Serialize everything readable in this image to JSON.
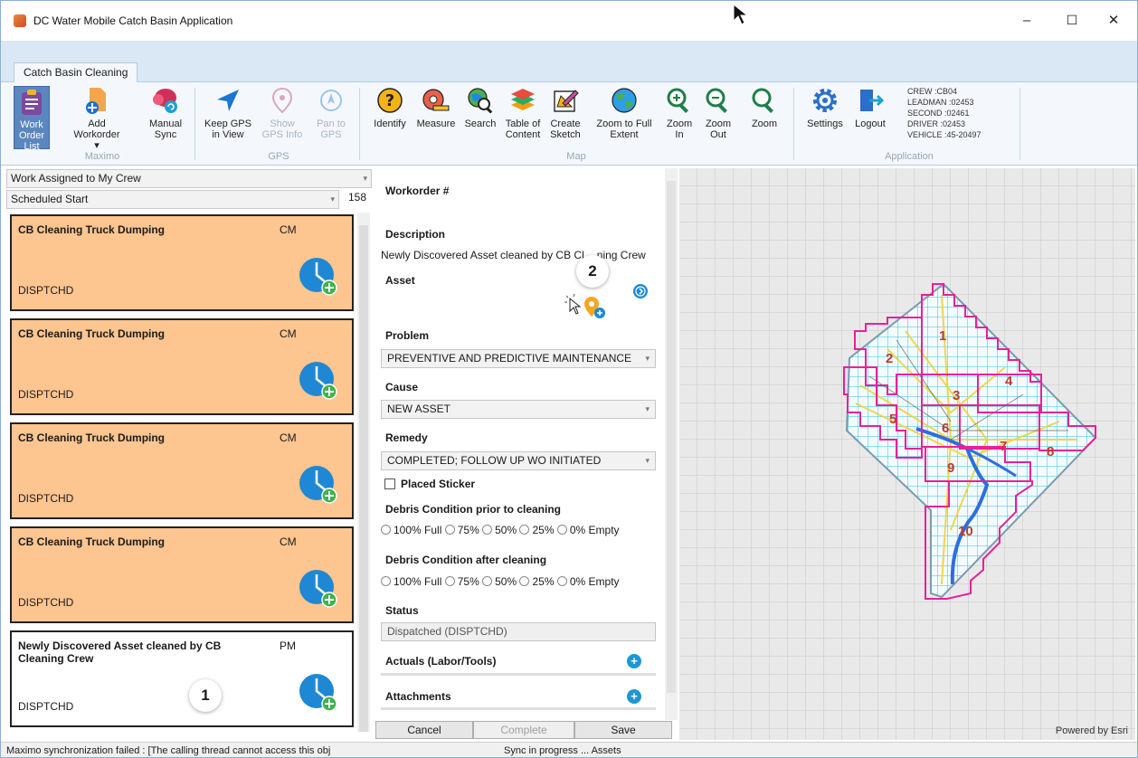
{
  "window": {
    "title": "DC Water Mobile Catch Basin Application",
    "controls": {
      "minimize": "–",
      "maximize": "☐",
      "close": "✕"
    }
  },
  "ribbon": {
    "tab": "Catch Basin Cleaning",
    "groups": {
      "maximo": {
        "label": "Maximo",
        "work_order_list": "Work Order List",
        "add_workorder": "Add Workorder ▾",
        "manual_sync": "Manual Sync"
      },
      "gps": {
        "label": "GPS",
        "keep_gps": "Keep GPS in View",
        "show_gps_info": "Show GPS Info",
        "pan_to_gps": "Pan to GPS"
      },
      "map": {
        "label": "Map",
        "identify": "Identify",
        "measure": "Measure",
        "search": "Search",
        "toc": "Table of Content",
        "sketch": "Create Sketch",
        "full_extent": "Zoom to Full Extent",
        "zoom_in": "Zoom In",
        "zoom_out": "Zoom Out",
        "zoom": "Zoom"
      },
      "application": {
        "label": "Application",
        "settings": "Settings",
        "logout": "Logout",
        "crew": "CREW :CB04",
        "leadman": "LEADMAN :02453",
        "second": "SECOND :02461",
        "driver": "DRIVER :02453",
        "vehicle": "VEHICLE :45-20497"
      }
    }
  },
  "left_panel": {
    "filter": "Work Assigned to My Crew",
    "sort": "Scheduled Start",
    "count": "158",
    "workorders": [
      {
        "title": "CB Cleaning Truck Dumping",
        "type": "CM",
        "status": "DISPTCHD"
      },
      {
        "title": "CB Cleaning Truck Dumping",
        "type": "CM",
        "status": "DISPTCHD"
      },
      {
        "title": "CB Cleaning Truck Dumping",
        "type": "CM",
        "status": "DISPTCHD"
      },
      {
        "title": "CB Cleaning Truck Dumping",
        "type": "CM",
        "status": "DISPTCHD"
      },
      {
        "title": "Newly Discovered Asset cleaned by CB Cleaning Crew",
        "type": "PM",
        "status": "DISPTCHD"
      }
    ],
    "badge": "1"
  },
  "form": {
    "workorder_label": "Workorder #",
    "description_label": "Description",
    "description_value": "Newly Discovered Asset cleaned by CB Cl",
    "description_tail": "ning Crew",
    "asset_label": "Asset",
    "badge": "2",
    "problem_label": "Problem",
    "problem_value": "PREVENTIVE AND PREDICTIVE MAINTENANCE",
    "cause_label": "Cause",
    "cause_value": "NEW ASSET",
    "remedy_label": "Remedy",
    "remedy_value": "COMPLETED; FOLLOW UP WO INITIATED",
    "placed_sticker": "Placed Sticker",
    "debris_prior_label": "Debris Condition prior to cleaning",
    "debris_after_label": "Debris Condition after cleaning",
    "debris_options": [
      "100% Full",
      "75%",
      "50%",
      "25%",
      "0% Empty"
    ],
    "status_label": "Status",
    "status_value": "Dispatched (DISPTCHD)",
    "actuals_label": "Actuals (Labor/Tools)",
    "attachments_label": "Attachments"
  },
  "buttons": {
    "cancel": "Cancel",
    "complete": "Complete",
    "save": "Save"
  },
  "map": {
    "powered_by": "Powered by Esri",
    "zone_labels": [
      "1",
      "2",
      "3",
      "4",
      "5",
      "6",
      "7",
      "8",
      "9",
      "10"
    ]
  },
  "statusbar": {
    "left": "Maximo synchronization failed : [The calling thread cannot access this obj",
    "center": "Sync in progress ... Assets"
  },
  "colors": {
    "card_orange": "#fdc590",
    "ribbon_bg": "#f4f8fc",
    "accent_blue": "#1e96d4",
    "zone_border": "#e8209a",
    "grid_cyan": "#27c6e0"
  }
}
